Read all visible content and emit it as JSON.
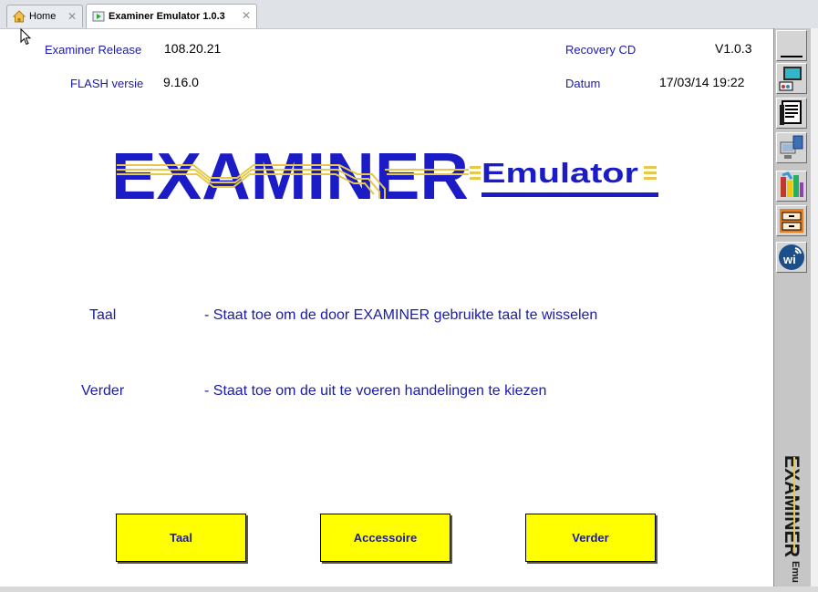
{
  "tabs": [
    {
      "label": "Home",
      "icon": "home-icon"
    },
    {
      "label": "Examiner Emulator 1.0.3",
      "icon": "emulator-icon"
    }
  ],
  "info": {
    "release_label": "Examiner Release",
    "release_value": "108.20.21",
    "flash_label": "FLASH versie",
    "flash_value": "9.16.0",
    "recovery_label": "Recovery CD",
    "recovery_value": "V1.0.3",
    "datum_label": "Datum",
    "datum_value": "17/03/14 19:22"
  },
  "logo": {
    "main": "EXAMINER",
    "sub": "Emulator"
  },
  "descriptions": [
    {
      "key": "Taal",
      "text": "- Staat toe om de door EXAMINER gebruikte taal te wisselen"
    },
    {
      "key": "Verder",
      "text": "- Staat toe om de uit te voeren handelingen te kiezen"
    }
  ],
  "buttons": {
    "taal": "Taal",
    "accessoire": "Accessoire",
    "verder": "Verder"
  },
  "sidebar_logo": {
    "main": "EXAMINER",
    "sub": "Emu"
  },
  "colors": {
    "accent_blue": "#1a1aa8",
    "button_yellow": "#ffff00",
    "logo_blue": "#1c1cc6",
    "logo_gold": "#e6c94a"
  }
}
